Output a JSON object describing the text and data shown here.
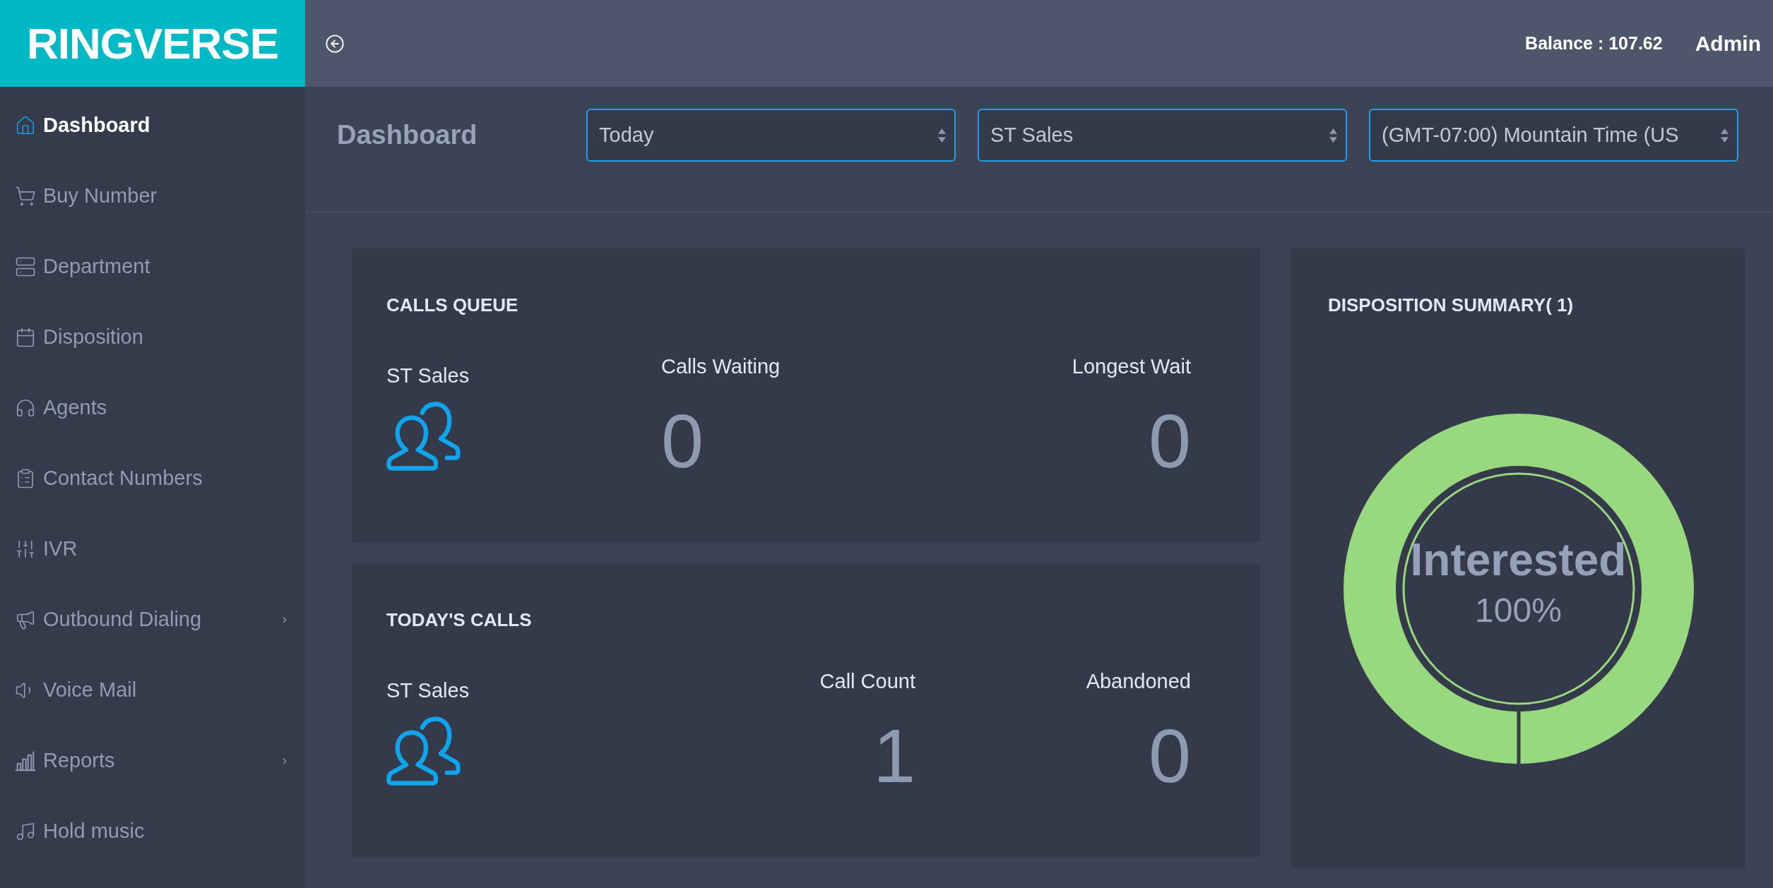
{
  "logo": "RINGVERSE",
  "sidebar": {
    "items": [
      {
        "label": "Dashboard",
        "selected": true,
        "has_submenu": false
      },
      {
        "label": "Buy Number",
        "selected": false,
        "has_submenu": false
      },
      {
        "label": "Department",
        "selected": false,
        "has_submenu": false
      },
      {
        "label": "Disposition",
        "selected": false,
        "has_submenu": false
      },
      {
        "label": "Agents",
        "selected": false,
        "has_submenu": false
      },
      {
        "label": "Contact Numbers",
        "selected": false,
        "has_submenu": false
      },
      {
        "label": "IVR",
        "selected": false,
        "has_submenu": false
      },
      {
        "label": "Outbound Dialing",
        "selected": false,
        "has_submenu": true
      },
      {
        "label": "Voice Mail",
        "selected": false,
        "has_submenu": false
      },
      {
        "label": "Reports",
        "selected": false,
        "has_submenu": true
      },
      {
        "label": "Hold music",
        "selected": false,
        "has_submenu": false
      }
    ]
  },
  "top_bar": {
    "balance": "Balance : 107.62",
    "user": "Admin"
  },
  "page_header": {
    "title": "Dashboard",
    "filters": [
      {
        "value": "Today"
      },
      {
        "value": "ST Sales"
      },
      {
        "value": "(GMT-07:00) Mountain Time (US"
      }
    ]
  },
  "stat_cards": [
    {
      "kind": "queue",
      "title": "CALLS QUEUE",
      "group": "ST Sales",
      "metrics": [
        {
          "label": "Calls Waiting",
          "value": "0"
        },
        {
          "label": "Longest Wait",
          "value": "0"
        }
      ]
    },
    {
      "kind": "totals",
      "title": "TODAY'S CALLS",
      "group": "ST Sales",
      "metrics": [
        {
          "label": "Call Count",
          "value": "1"
        },
        {
          "label": "Abandoned",
          "value": "0"
        }
      ]
    }
  ],
  "disposition": {
    "title": "DISPOSITION SUMMARY( 1)",
    "center_label": "Interested",
    "center_value": "100%"
  }
}
